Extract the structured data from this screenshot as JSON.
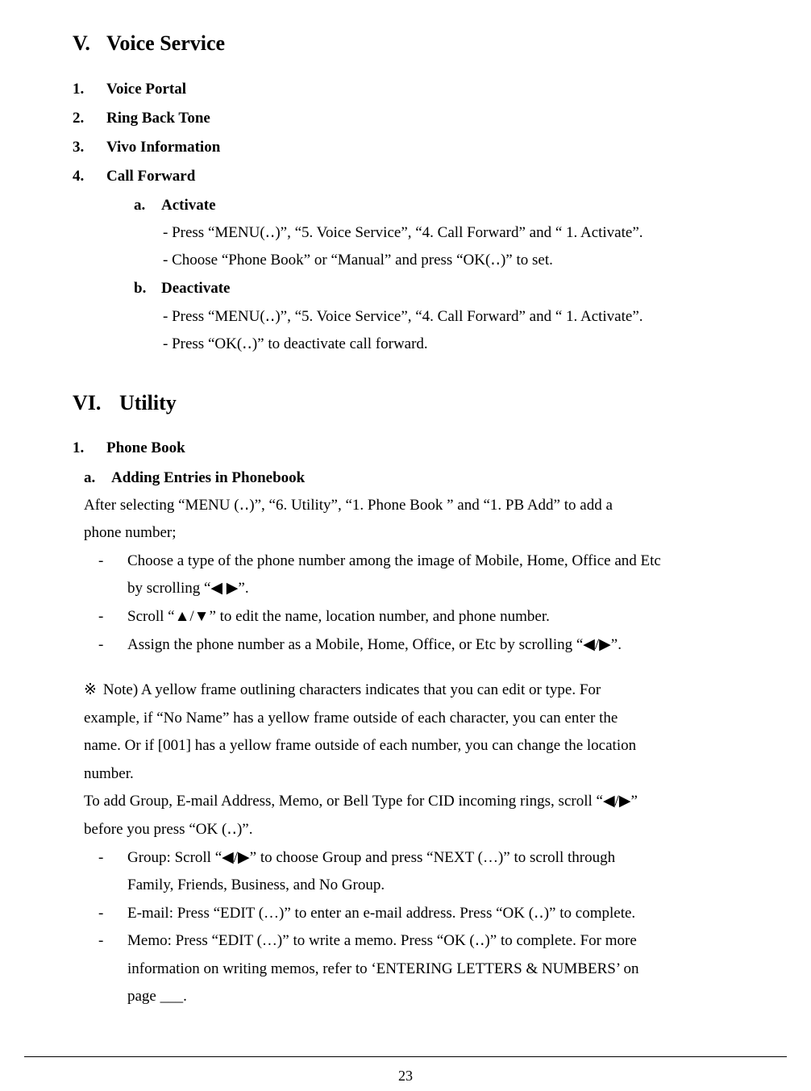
{
  "section_v": {
    "number": "V.",
    "title": "Voice Service",
    "items": [
      {
        "num": "1.",
        "label": "Voice Portal"
      },
      {
        "num": "2.",
        "label": "Ring Back Tone"
      },
      {
        "num": "3.",
        "label": "Vivo Information"
      },
      {
        "num": "4.",
        "label": "Call Forward"
      }
    ],
    "call_forward": {
      "a": {
        "num": "a.",
        "label": "Activate",
        "lines": [
          "- Press “MENU(‥)”, “5. Voice Service”, “4. Call Forward” and “ 1. Activate”.",
          "- Choose “Phone Book” or “Manual” and press “OK(‥)” to set."
        ]
      },
      "b": {
        "num": "b.",
        "label": "Deactivate",
        "lines": [
          "-  Press “MENU(‥)”, “5. Voice Service”, “4. Call Forward” and “ 1. Activate”.",
          "-  Press “OK(‥)”    to deactivate call forward."
        ]
      }
    }
  },
  "section_vi": {
    "number": "VI.",
    "title": "Utility",
    "item1": {
      "num": "1.",
      "label": "Phone Book"
    },
    "item_a": {
      "num": "a.",
      "label": "Adding Entries in Phonebook"
    },
    "intro_line1": "After selecting “MENU (‥)”, “6. Utility”, “1. Phone Book ” and “1. PB Add” to add a",
    "intro_line2": "phone number;",
    "bullets": [
      {
        "bullet": "-",
        "line1": "Choose a type of the phone number among the image of Mobile, Home, Office and Etc",
        "line2": "by scrolling “◀  ▶”."
      },
      {
        "bullet": "-",
        "line1": "Scroll “▲/▼” to edit the name, location number, and phone number.",
        "line2": ""
      },
      {
        "bullet": "-",
        "line1": "Assign the phone number as a Mobile, Home, Office, or Etc by scrolling “◀/▶”.",
        "line2": ""
      }
    ],
    "note": {
      "mark": "※",
      "line1": "Note) A yellow frame outlining characters indicates that you can edit or type. For",
      "line2": "example, if “No Name” has a yellow frame outside of each character, you can enter the",
      "line3": "name. Or if [001] has a yellow frame outside of each number, you can change the location",
      "line4": "number."
    },
    "add_group_line1": "To add Group, E-mail Address, Memo, or Bell Type for CID incoming rings, scroll “◀/▶”",
    "add_group_line2": "before you press “OK (‥)”.",
    "bullets2": [
      {
        "bullet": "-",
        "line1": "Group: Scroll “◀/▶” to choose Group and press “NEXT (…)” to scroll through",
        "line2": "Family, Friends, Business, and No Group.",
        "line3": ""
      },
      {
        "bullet": "-",
        "line1": "E-mail: Press “EDIT (…)” to enter an e-mail address. Press “OK (‥)” to complete.",
        "line2": "",
        "line3": ""
      },
      {
        "bullet": "-",
        "line1": "Memo: Press “EDIT (…)” to write a memo. Press “OK (‥)” to complete.    For more",
        "line2": "information on writing memos, refer to ‘ENTERING LETTERS & NUMBERS’ on",
        "line3": "page ___."
      }
    ]
  },
  "footer": {
    "page_number": "23"
  }
}
